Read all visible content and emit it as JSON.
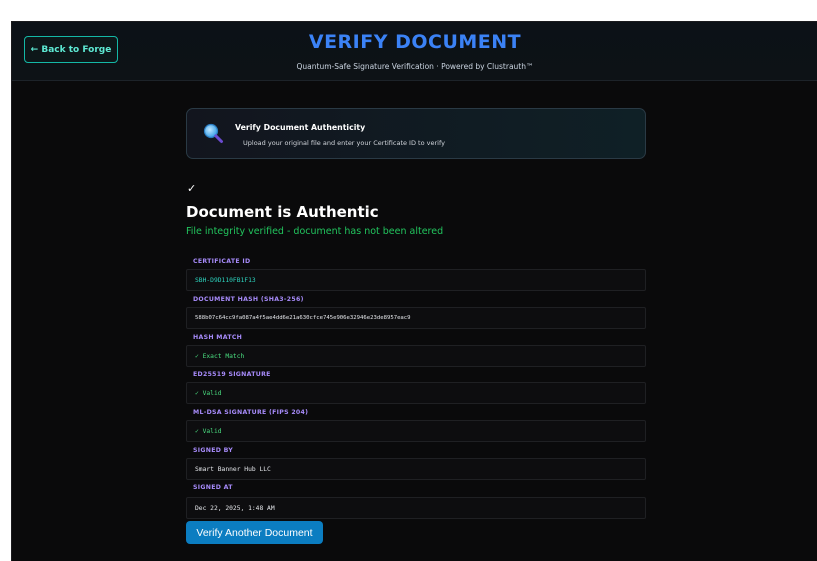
{
  "header": {
    "back_label": "← Back to Forge",
    "title": "VERIFY DOCUMENT",
    "subtitle": "Quantum-Safe Signature Verification · Powered by Clustrauth™"
  },
  "info_card": {
    "icon": "magnifier-icon",
    "title": "Verify Document Authenticity",
    "subtitle": "Upload your original file and enter your Certificate ID to verify"
  },
  "result": {
    "check": "✓",
    "title": "Document is Authentic",
    "subtitle": "File integrity verified - document has not been altered",
    "fields": [
      {
        "label": "CERTIFICATE ID",
        "value": "SBH-D9D110FB1F13"
      },
      {
        "label": "DOCUMENT HASH (SHA3-256)",
        "value": "588b07c64cc9fa087a4f5ae4dd6e21a630cfce745e906e32946e23de8957eac9"
      },
      {
        "label": "HASH MATCH",
        "value": "✓ Exact Match"
      },
      {
        "label": "ED25519 SIGNATURE",
        "value": "✓ Valid"
      },
      {
        "label": "ML-DSA SIGNATURE (FIPS 204)",
        "value": "✓ Valid"
      },
      {
        "label": "SIGNED BY",
        "value": "Smart Banner Hub LLC"
      },
      {
        "label": "SIGNED AT",
        "value": "Dec 22, 2025, 1:48 AM"
      }
    ]
  },
  "actions": {
    "verify_another": "Verify Another Document"
  },
  "colors": {
    "accent_blue": "#3b82f6",
    "teal": "#2dd4bf",
    "success_green": "#22c55e",
    "label_purple": "#a78bfa",
    "button_blue": "#0b7dc1"
  }
}
